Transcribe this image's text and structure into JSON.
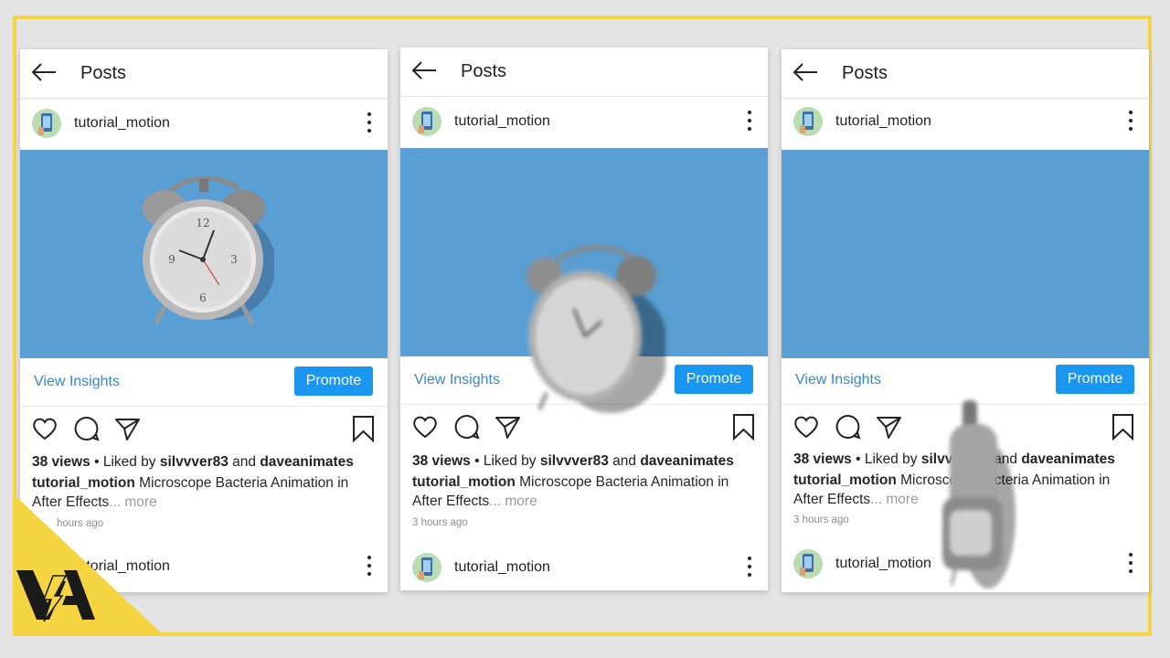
{
  "header": {
    "title": "Posts"
  },
  "post": {
    "username": "tutorial_motion",
    "view_insights": "View Insights",
    "promote": "Promote",
    "views": "38 views",
    "liked_by_prefix": " • Liked by ",
    "liker1": "silvvver83",
    "and": " and ",
    "liker2": "daveanimates",
    "caption_user": "tutorial_motion",
    "caption_text": " Microscope Bacteria Animation in After Effects",
    "ellipsis": "...",
    "more": " more",
    "time": "3 hours ago",
    "time_partial": "hours ago"
  },
  "colors": {
    "accent": "#f5d442",
    "media_bg": "#599fd3",
    "promote": "#1896f0",
    "link": "#3787c8"
  },
  "icons": [
    "back-arrow-icon",
    "more-vert-icon",
    "heart-icon",
    "comment-icon",
    "share-icon",
    "bookmark-icon",
    "alarm-clock-image",
    "va-logo"
  ]
}
